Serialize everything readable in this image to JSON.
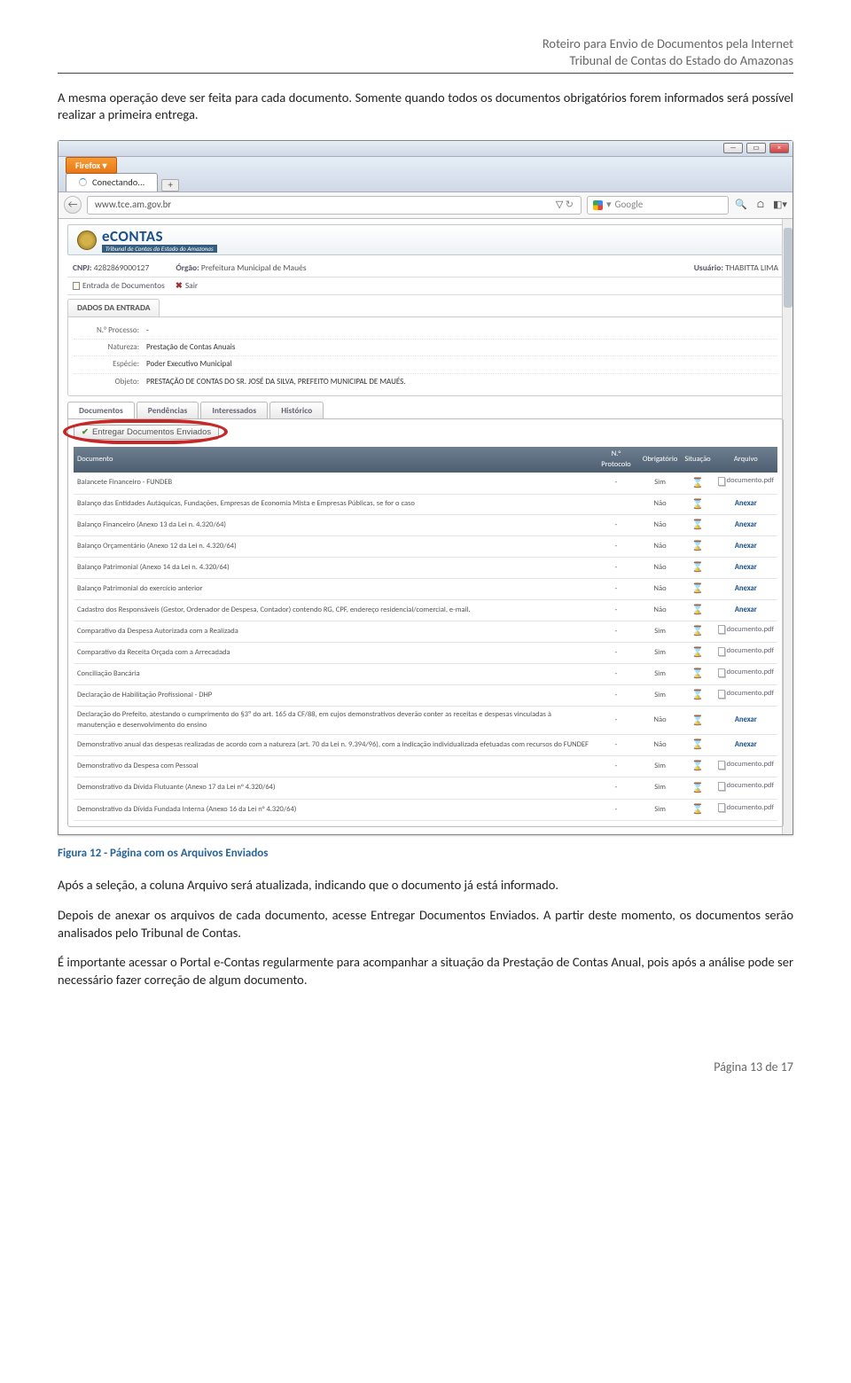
{
  "doc_header": {
    "line1": "Roteiro para Envio de Documentos pela Internet",
    "line2": "Tribunal de Contas do Estado do Amazonas"
  },
  "paragraph_1": "A mesma operação deve ser feita para cada documento. Somente quando todos os documentos obrigatórios forem informados será possível realizar a primeira entrega.",
  "browser": {
    "firefox_label": "Firefox ▾",
    "tab_label": "Conectando...",
    "url": "www.tce.am.gov.br",
    "refresh": "↻",
    "search_placeholder": "Google",
    "search_icon": "🔍",
    "home_icon": "⌂",
    "bookmark_icon": "◧▾"
  },
  "econtas": {
    "title": "eCONTAS",
    "subtitle": "Tribunal de Contas do Estado do Amazonas",
    "cnpj_label": "CNPJ:",
    "cnpj_value": "4282869000127",
    "orgao_label": "Órgão:",
    "orgao_value": "Prefeitura Municipal de Maués",
    "usuario_label": "Usuário:",
    "usuario_value": "THABITTA LIMA",
    "menu_entrada": "Entrada de Documentos",
    "menu_sair": "Sair"
  },
  "dados": {
    "title": "DADOS DA ENTRADA",
    "rows": [
      {
        "k": "N.° Processo:",
        "v": "-"
      },
      {
        "k": "Natureza:",
        "v": "Prestação de Contas Anuais"
      },
      {
        "k": "Espécie:",
        "v": "Poder Executivo Municipal"
      },
      {
        "k": "Objeto:",
        "v": "PRESTAÇÃO DE CONTAS DO SR. JOSÉ DA SILVA, PREFEITO MUNICIPAL DE MAUÉS."
      }
    ]
  },
  "tabs": [
    "Documentos",
    "Pendências",
    "Interessados",
    "Histórico"
  ],
  "entregar_label": "Entregar Documentos Enviados",
  "table": {
    "headers": [
      "Documento",
      "N.° Protocolo",
      "Obrigatório",
      "Situação",
      "Arquivo"
    ],
    "rows": [
      {
        "doc": "Balancete Financeiro - FUNDEB",
        "proto": "-",
        "obrig": "Sim",
        "arquivo": "documento.pdf"
      },
      {
        "doc": "Balanço das Entidades Autáquicas, Fundações, Empresas de Economia Mista e Empresas Públicas, se for o caso",
        "proto": "",
        "obrig": "Não",
        "arquivo": "Anexar"
      },
      {
        "doc": "Balanço Financeiro (Anexo 13 da Lei n. 4.320/64)",
        "proto": "-",
        "obrig": "Não",
        "arquivo": "Anexar"
      },
      {
        "doc": "Balanço Orçamentário (Anexo 12 da Lei n. 4.320/64)",
        "proto": "-",
        "obrig": "Não",
        "arquivo": "Anexar"
      },
      {
        "doc": "Balanço Patrimonial (Anexo 14 da Lei n. 4.320/64)",
        "proto": "-",
        "obrig": "Não",
        "arquivo": "Anexar"
      },
      {
        "doc": "Balanço Patrimonial do exercício anterior",
        "proto": "-",
        "obrig": "Não",
        "arquivo": "Anexar"
      },
      {
        "doc": "Cadastro dos Responsáveis (Gestor, Ordenador de Despesa, Contador) contendo RG, CPF, endereço residencial/comercial, e-mail.",
        "proto": "-",
        "obrig": "Não",
        "arquivo": "Anexar"
      },
      {
        "doc": "Comparativo da Despesa Autorizada com a Realizada",
        "proto": "-",
        "obrig": "Sim",
        "arquivo": "documento.pdf"
      },
      {
        "doc": "Comparativo da Receita Orçada com a Arrecadada",
        "proto": "-",
        "obrig": "Sim",
        "arquivo": "documento.pdf"
      },
      {
        "doc": "Conciliação Bancária",
        "proto": "-",
        "obrig": "Sim",
        "arquivo": "documento.pdf"
      },
      {
        "doc": "Declaração de Habilitação Profissional - DHP",
        "proto": "-",
        "obrig": "Sim",
        "arquivo": "documento.pdf"
      },
      {
        "doc": "Declaração do Prefeito, atestando o cumprimento do §3º do art. 165 da CF/88, em cujos demonstrativos deverão conter as receitas e despesas vinculadas à manutenção e desenvolvimento do ensino",
        "proto": "-",
        "obrig": "Não",
        "arquivo": "Anexar"
      },
      {
        "doc": "Demonstrativo anual das despesas realizadas de acordo com a natureza (art. 70 da Lei n. 9.394/96), com a indicação individualizada efetuadas com recursos do FUNDEF",
        "proto": "-",
        "obrig": "Não",
        "arquivo": "Anexar"
      },
      {
        "doc": "Demonstrativo da Despesa com Pessoal",
        "proto": "-",
        "obrig": "Sim",
        "arquivo": "documento.pdf"
      },
      {
        "doc": "Demonstrativo da Dívida Flutuante (Anexo 17 da Lei n° 4.320/64)",
        "proto": "-",
        "obrig": "Sim",
        "arquivo": "documento.pdf"
      },
      {
        "doc": "Demonstrativo da Dívida Fundada Interna (Anexo 16 da Lei n° 4.320/64)",
        "proto": "-",
        "obrig": "Sim",
        "arquivo": "documento.pdf"
      }
    ]
  },
  "figure_caption": "Figura 12 - Página com os Arquivos Enviados",
  "paragraph_2": "Após a seleção, a coluna Arquivo será atualizada, indicando que o documento já está informado.",
  "paragraph_3": "Depois de anexar os arquivos de cada documento, acesse Entregar Documentos Enviados. A partir deste momento, os documentos serão analisados pelo Tribunal de Contas.",
  "paragraph_4": "É importante acessar o Portal e-Contas regularmente para acompanhar a situação da Prestação de Contas Anual, pois após a análise pode ser necessário fazer correção de algum documento.",
  "footer": "Página 13 de 17"
}
